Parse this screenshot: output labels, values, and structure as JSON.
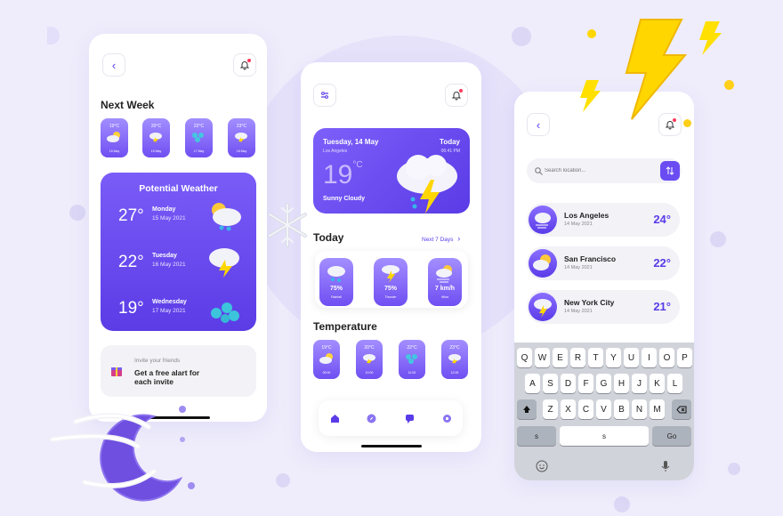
{
  "colors": {
    "accent": "#6a4cf2",
    "accent_light": "#a38eff",
    "background": "#efedfb",
    "notify": "#ff3b5c",
    "bolt": "#ffd600"
  },
  "left": {
    "back_icon": "chevron-left-icon",
    "bell_icon": "bell-icon",
    "section_title": "Next Week",
    "week": [
      {
        "temp": "19°C",
        "date": "15 May"
      },
      {
        "temp": "20°C",
        "date": "15 May"
      },
      {
        "temp": "22°C",
        "date": "17 May"
      },
      {
        "temp": "23°C",
        "date": "18 May"
      }
    ],
    "potential": {
      "title": "Potential Weather",
      "rows": [
        {
          "temp": "27°",
          "day": "Monday",
          "date": "15 May 2021"
        },
        {
          "temp": "22°",
          "day": "Tuesday",
          "date": "16 May 2021"
        },
        {
          "temp": "19°",
          "day": "Wednesday",
          "date": "17 May 2021"
        }
      ]
    },
    "invite": {
      "small": "Invite your friends",
      "line1": "Get a free alart for",
      "line2": "each invite"
    }
  },
  "center": {
    "hero": {
      "date": "Tuesday, 14 May",
      "city": "Los Angeles",
      "today": "Today",
      "time": "06:41 PM",
      "temp": "19",
      "unit": "°C",
      "condition": "Sunny Cloudy"
    },
    "today_title": "Today",
    "next_link": "Next 7 Days",
    "stats": [
      {
        "value": "75%",
        "label": "Rainfall"
      },
      {
        "value": "75%",
        "label": "Thunder"
      },
      {
        "value": "7 km/h",
        "label": "Wind"
      }
    ],
    "temperature_title": "Temperature",
    "temps": [
      {
        "temp": "19°C",
        "date": "09:00"
      },
      {
        "temp": "20°C",
        "date": "10:00"
      },
      {
        "temp": "22°C",
        "date": "11:00"
      },
      {
        "temp": "23°C",
        "date": "12:00"
      }
    ],
    "nav": [
      "home-icon",
      "compass-icon",
      "chat-icon",
      "settings-icon"
    ]
  },
  "right": {
    "search_placeholder": "Search location...",
    "cities": [
      {
        "name": "Los Angeles",
        "date": "14 May 2021",
        "temp": "24°"
      },
      {
        "name": "San Francisco",
        "date": "14 May 2021",
        "temp": "22°"
      },
      {
        "name": "New York City",
        "date": "14 May 2021",
        "temp": "21°"
      }
    ],
    "keyboard": {
      "row1": [
        "Q",
        "W",
        "E",
        "R",
        "T",
        "Y",
        "U",
        "I",
        "O",
        "P"
      ],
      "row2": [
        "A",
        "S",
        "D",
        "F",
        "G",
        "H",
        "J",
        "K",
        "L"
      ],
      "row3": [
        "Z",
        "X",
        "C",
        "V",
        "B",
        "N",
        "M"
      ],
      "left_key": "s",
      "space": "s",
      "go": "Go",
      "emoji_icon": "emoji-icon",
      "mic_icon": "microphone-icon"
    }
  }
}
